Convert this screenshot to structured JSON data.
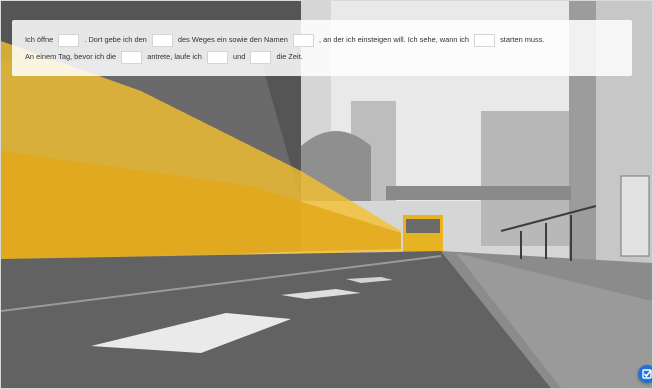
{
  "exercise": {
    "line1": {
      "t1": "Ich öffne",
      "t2": ". Dort gebe ich den",
      "t3": "des Weges ein sowie den Namen",
      "t4": ", an der ich einsteigen will. Ich sehe, wann ich",
      "t5": "starten muss."
    },
    "line2": {
      "t1": "An einem Tag, bevor ich die",
      "t2": "antrete, laufe ich",
      "t3": "und",
      "t4": "die Zeit."
    },
    "blanks": [
      "",
      "",
      "",
      "",
      "",
      "",
      "",
      ""
    ]
  },
  "scene": {
    "accent_color": "#f2c12e"
  },
  "corner_button": {
    "icon": "checkmark-icon"
  }
}
